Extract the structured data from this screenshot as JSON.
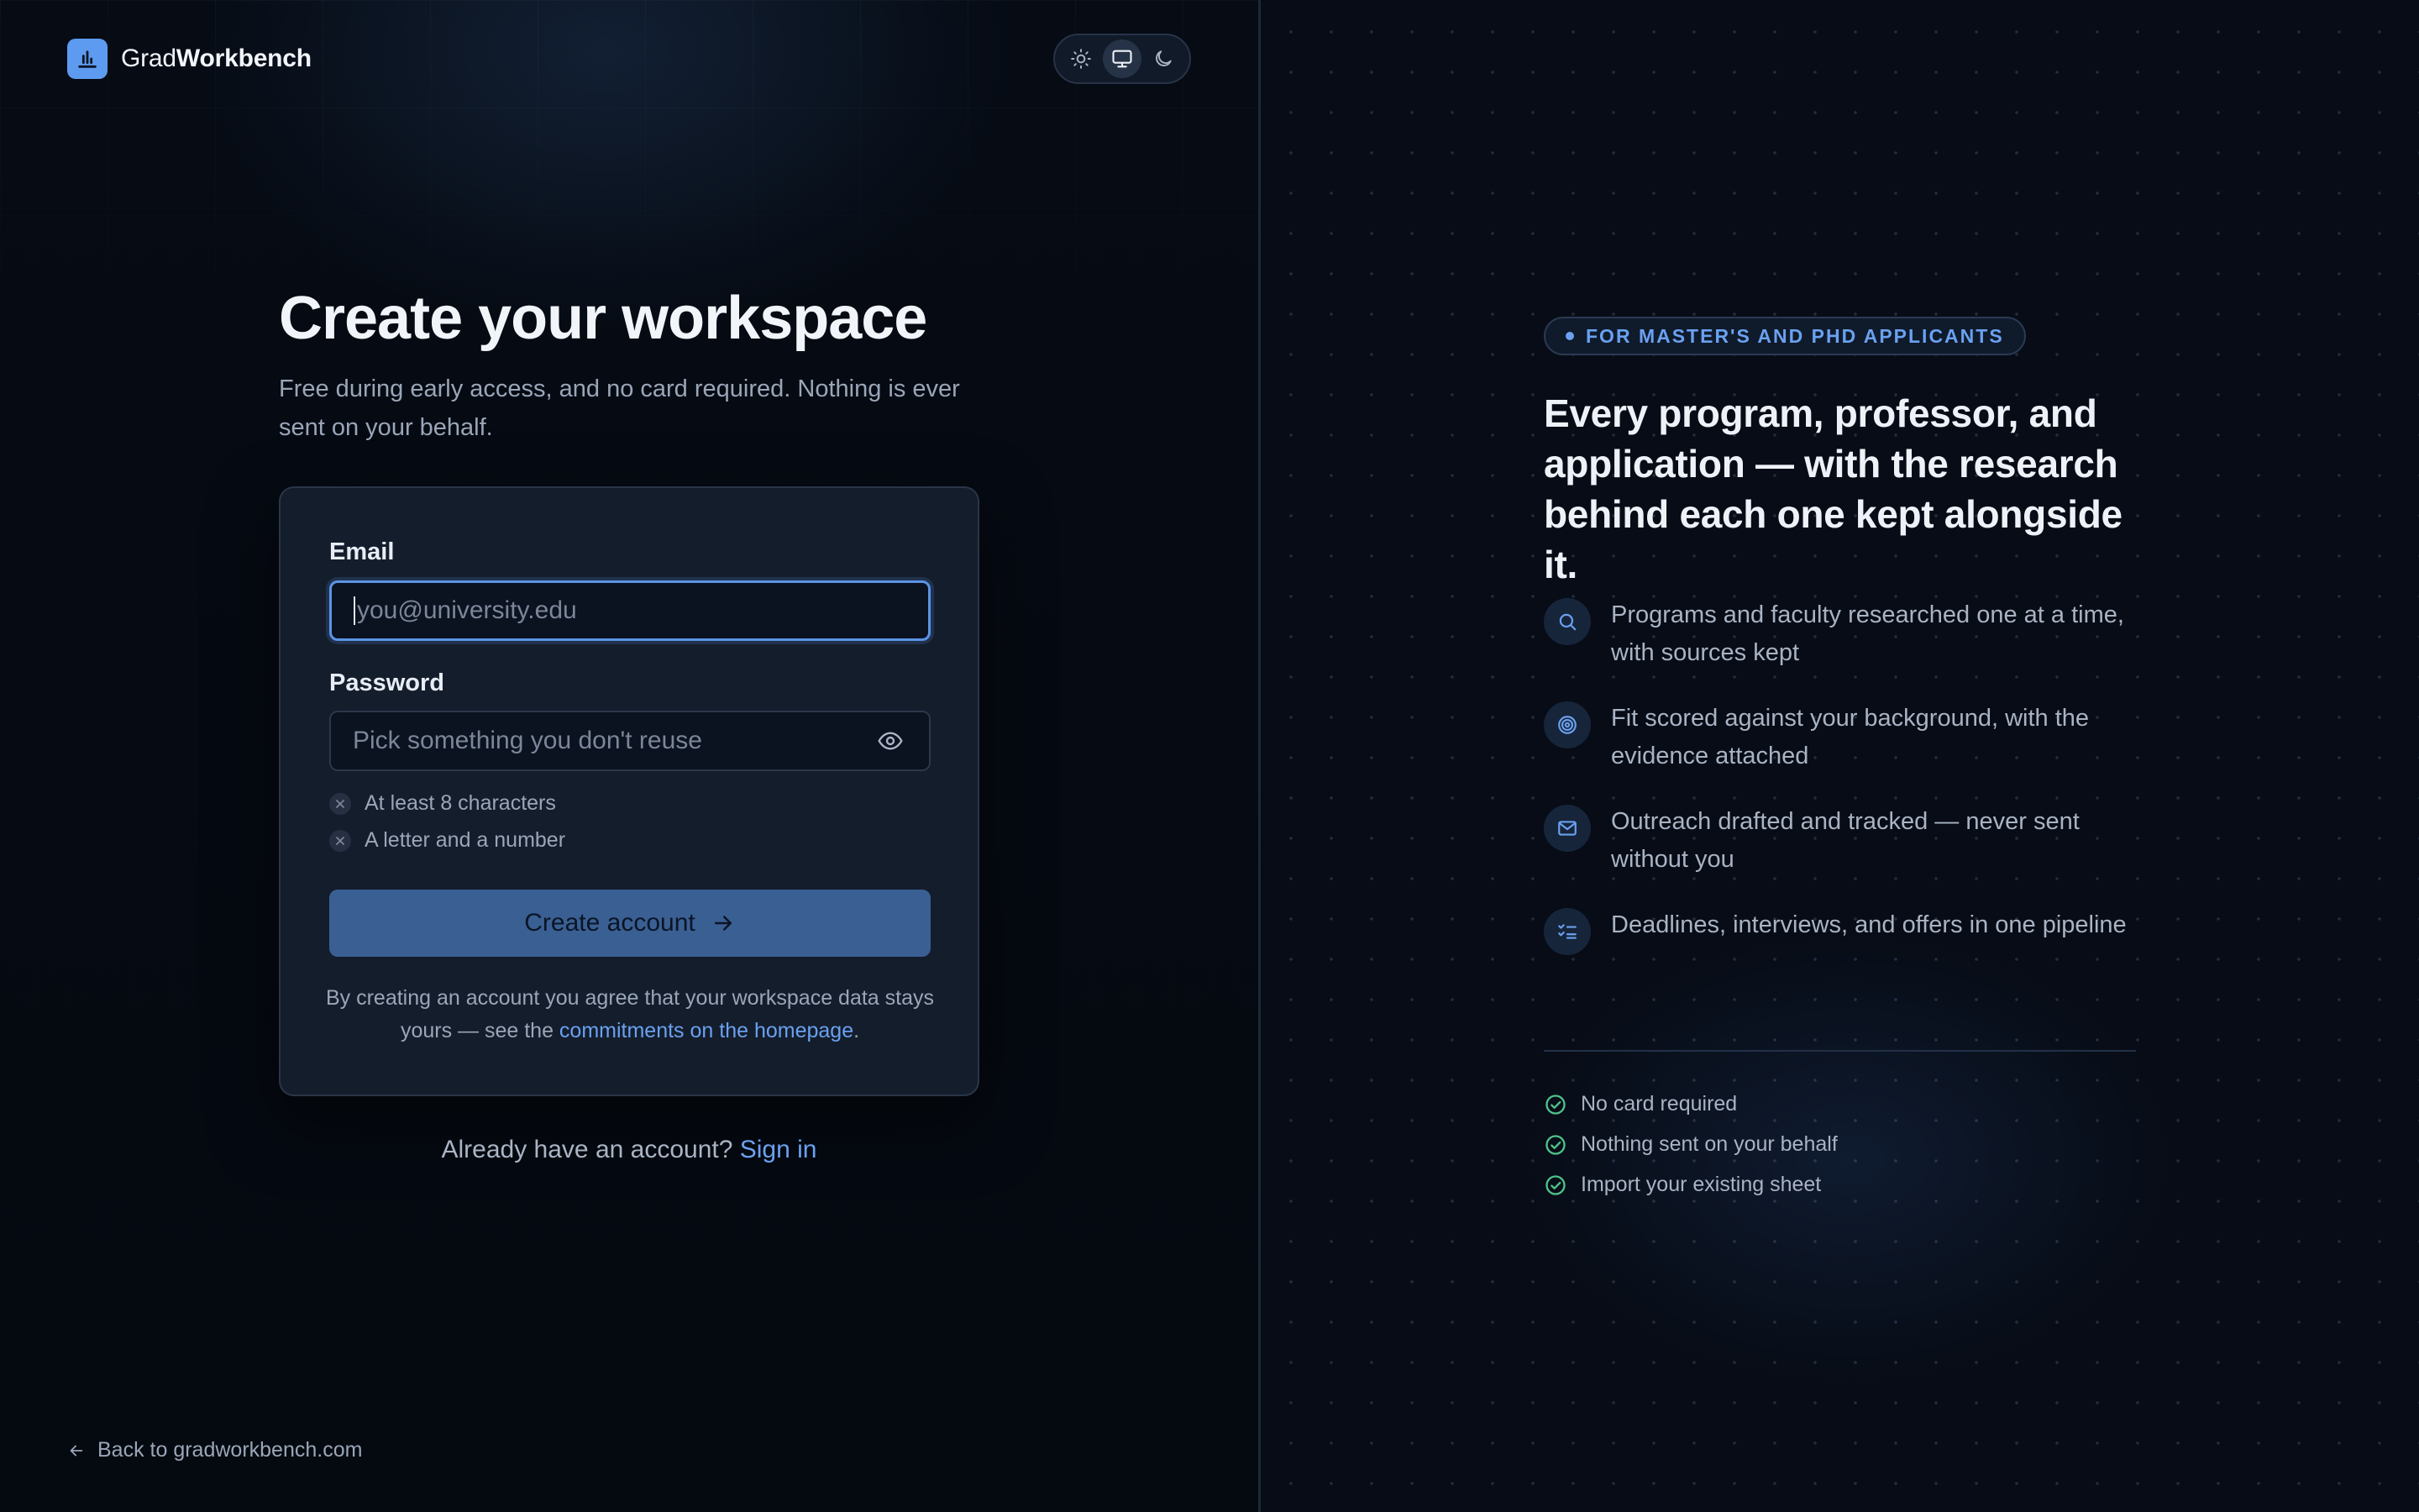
{
  "brand": {
    "name_light": "Grad",
    "name_bold": "Workbench"
  },
  "theme_switch": {
    "options": [
      "light",
      "system",
      "dark"
    ],
    "selected": "system"
  },
  "form": {
    "title": "Create your workspace",
    "subtitle": "Free during early access, and no card required. Nothing is ever sent on your behalf.",
    "email_label": "Email",
    "email_value": "",
    "email_placeholder": "you@university.edu",
    "password_label": "Password",
    "password_value": "",
    "password_placeholder": "Pick something you don't reuse",
    "requirements": [
      "At least 8 characters",
      "A letter and a number"
    ],
    "submit_label": "Create account",
    "terms_prefix": "By creating an account you agree that your workspace data stays yours — see the ",
    "terms_link": "commitments on the homepage",
    "terms_suffix": ".",
    "signin_prompt": "Already have an account?",
    "signin_link": "Sign in",
    "back_link": "Back to gradworkbench.com"
  },
  "marketing": {
    "badge": "FOR MASTER'S AND PHD APPLICANTS",
    "headline": "Every program, professor, and application — with the research behind each one kept alongside it.",
    "features": [
      {
        "icon": "search-icon",
        "text": "Programs and faculty researched one at a time, with sources kept"
      },
      {
        "icon": "target-icon",
        "text": "Fit scored against your background, with the evidence attached"
      },
      {
        "icon": "mail-icon",
        "text": "Outreach drafted and tracked — never sent without you"
      },
      {
        "icon": "list-check-icon",
        "text": "Deadlines, interviews, and offers in one pipeline"
      }
    ],
    "checks": [
      "No card required",
      "Nothing sent on your behalf",
      "Import your existing sheet"
    ]
  },
  "colors": {
    "accent": "#6aa1f0",
    "button": "#3a5f93",
    "check": "#4fc38a",
    "background": "#060b14"
  }
}
